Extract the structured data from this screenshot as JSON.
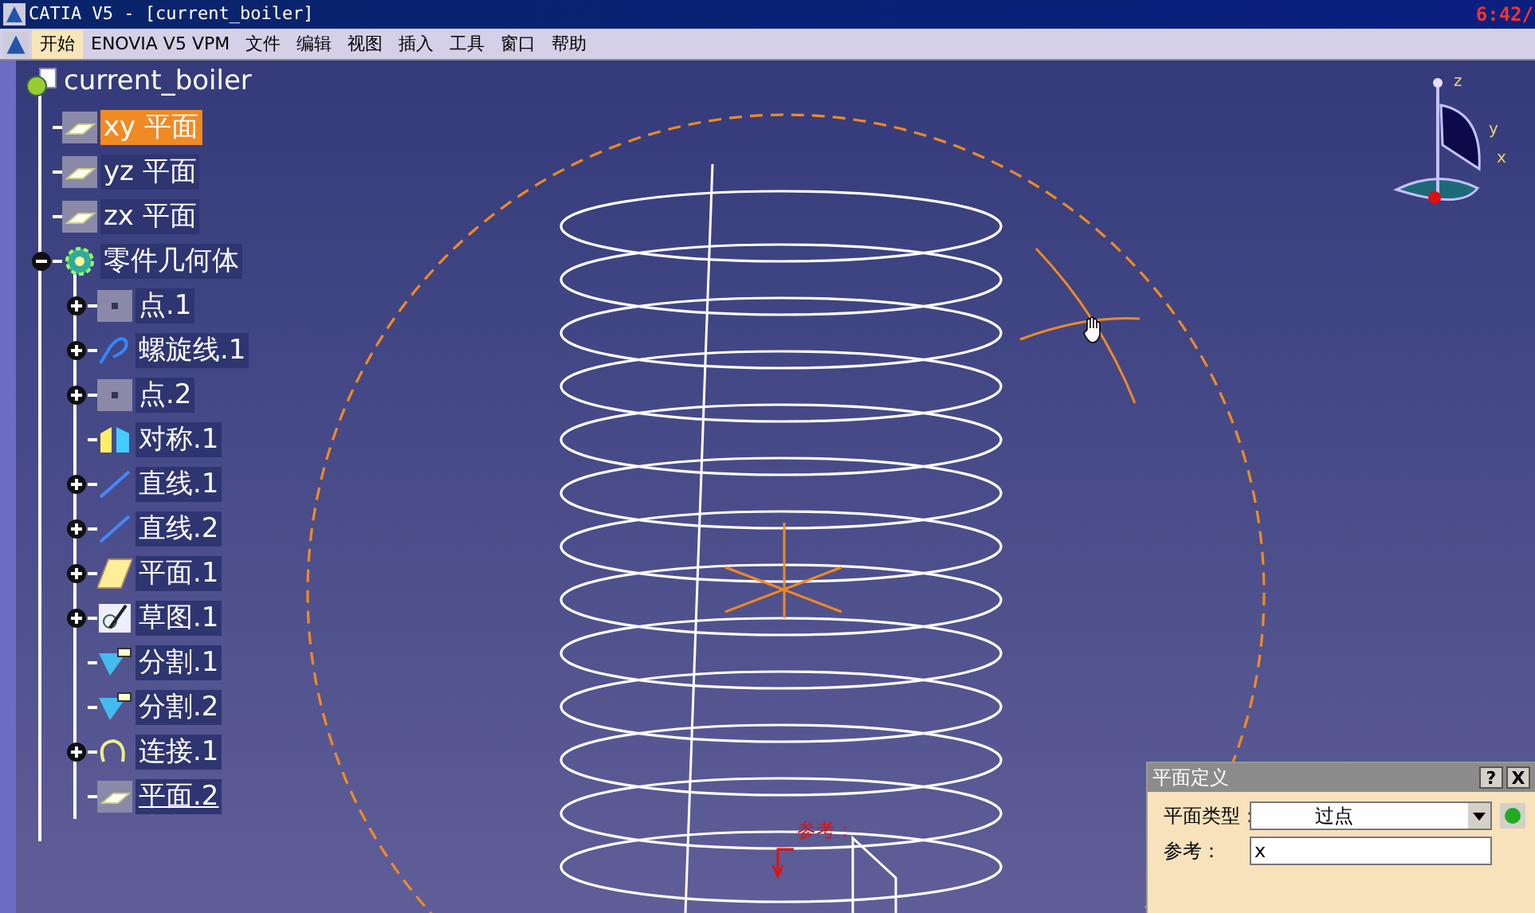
{
  "window": {
    "title": "CATIA V5 - [current_boiler]",
    "clock": "6:42/"
  },
  "menu": [
    {
      "label": "开始",
      "selected": true
    },
    {
      "label": "ENOVIA V5 VPM",
      "selected": false
    },
    {
      "label": "文件",
      "selected": false
    },
    {
      "label": "编辑",
      "selected": false
    },
    {
      "label": "视图",
      "selected": false
    },
    {
      "label": "插入",
      "selected": false
    },
    {
      "label": "工具",
      "selected": false
    },
    {
      "label": "窗口",
      "selected": false
    },
    {
      "label": "帮助",
      "selected": false
    }
  ],
  "tree": {
    "label": "current_boiler",
    "kind": "document",
    "children": [
      {
        "label": "xy 平面",
        "kind": "plane",
        "selected": true,
        "current": false
      },
      {
        "label": "yz 平面",
        "kind": "plane",
        "selected": false,
        "current": false
      },
      {
        "label": "zx 平面",
        "kind": "plane",
        "selected": false,
        "current": false
      },
      {
        "label": "零件几何体",
        "kind": "body",
        "selected": false,
        "current": false,
        "expanded": true,
        "children": [
          {
            "label": "点.1",
            "kind": "point",
            "selected": false,
            "current": false,
            "expanded": false
          },
          {
            "label": "螺旋线.1",
            "kind": "helix",
            "selected": false,
            "current": false,
            "expanded": false
          },
          {
            "label": "点.2",
            "kind": "point",
            "selected": false,
            "current": false,
            "expanded": false
          },
          {
            "label": "对称.1",
            "kind": "symmetry",
            "selected": false,
            "current": false
          },
          {
            "label": "直线.1",
            "kind": "line",
            "selected": false,
            "current": false,
            "expanded": false
          },
          {
            "label": "直线.2",
            "kind": "line",
            "selected": false,
            "current": false,
            "expanded": false
          },
          {
            "label": "平面.1",
            "kind": "plane_feature",
            "selected": false,
            "current": false,
            "expanded": false
          },
          {
            "label": "草图.1",
            "kind": "sketch",
            "selected": false,
            "current": false,
            "expanded": false
          },
          {
            "label": "分割.1",
            "kind": "split",
            "selected": false,
            "current": false
          },
          {
            "label": "分割.2",
            "kind": "split",
            "selected": false,
            "current": false
          },
          {
            "label": "连接.1",
            "kind": "join",
            "selected": false,
            "current": false,
            "expanded": false
          },
          {
            "label": "平面.2",
            "kind": "plane",
            "selected": false,
            "current": true
          }
        ]
      }
    ]
  },
  "viewport": {
    "annotation": "参考：",
    "compass_axes": [
      "z",
      "y",
      "x"
    ]
  },
  "dialog": {
    "title": "平面定义",
    "help": "?",
    "close": "X",
    "fields": [
      {
        "label": "平面类型：",
        "value": "过点",
        "kind": "combo"
      },
      {
        "label": "参考：",
        "value": "x",
        "kind": "text"
      }
    ]
  }
}
